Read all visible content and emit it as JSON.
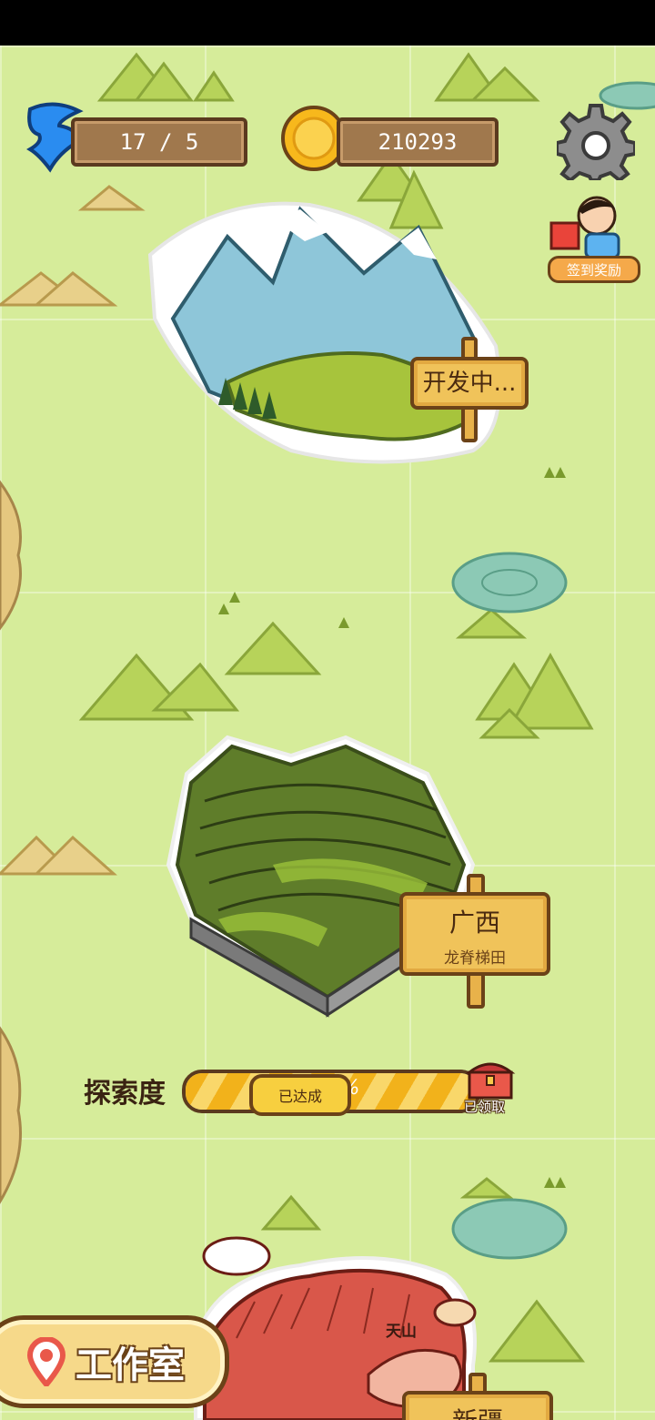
{
  "hud": {
    "energy_value": "17 / 5",
    "coins_value": "210293",
    "checkin_label": "签到奖励"
  },
  "regions": [
    {
      "sign": "开发中..."
    },
    {
      "title": "广西",
      "subtitle": "龙脊梯田",
      "progress_label": "探索度",
      "progress_text": "100%",
      "progress_fraction": 1.0,
      "status_badge": "已达成",
      "chest_label": "已领取"
    },
    {
      "title": "新疆",
      "landmark_text": "天山"
    }
  ],
  "nav": {
    "studio_label": "工作室"
  },
  "colors": {
    "map_bg": "#d6ec9a",
    "wood": "#a0784d",
    "sign": "#f0c35a",
    "accent_red": "#e9584a"
  }
}
